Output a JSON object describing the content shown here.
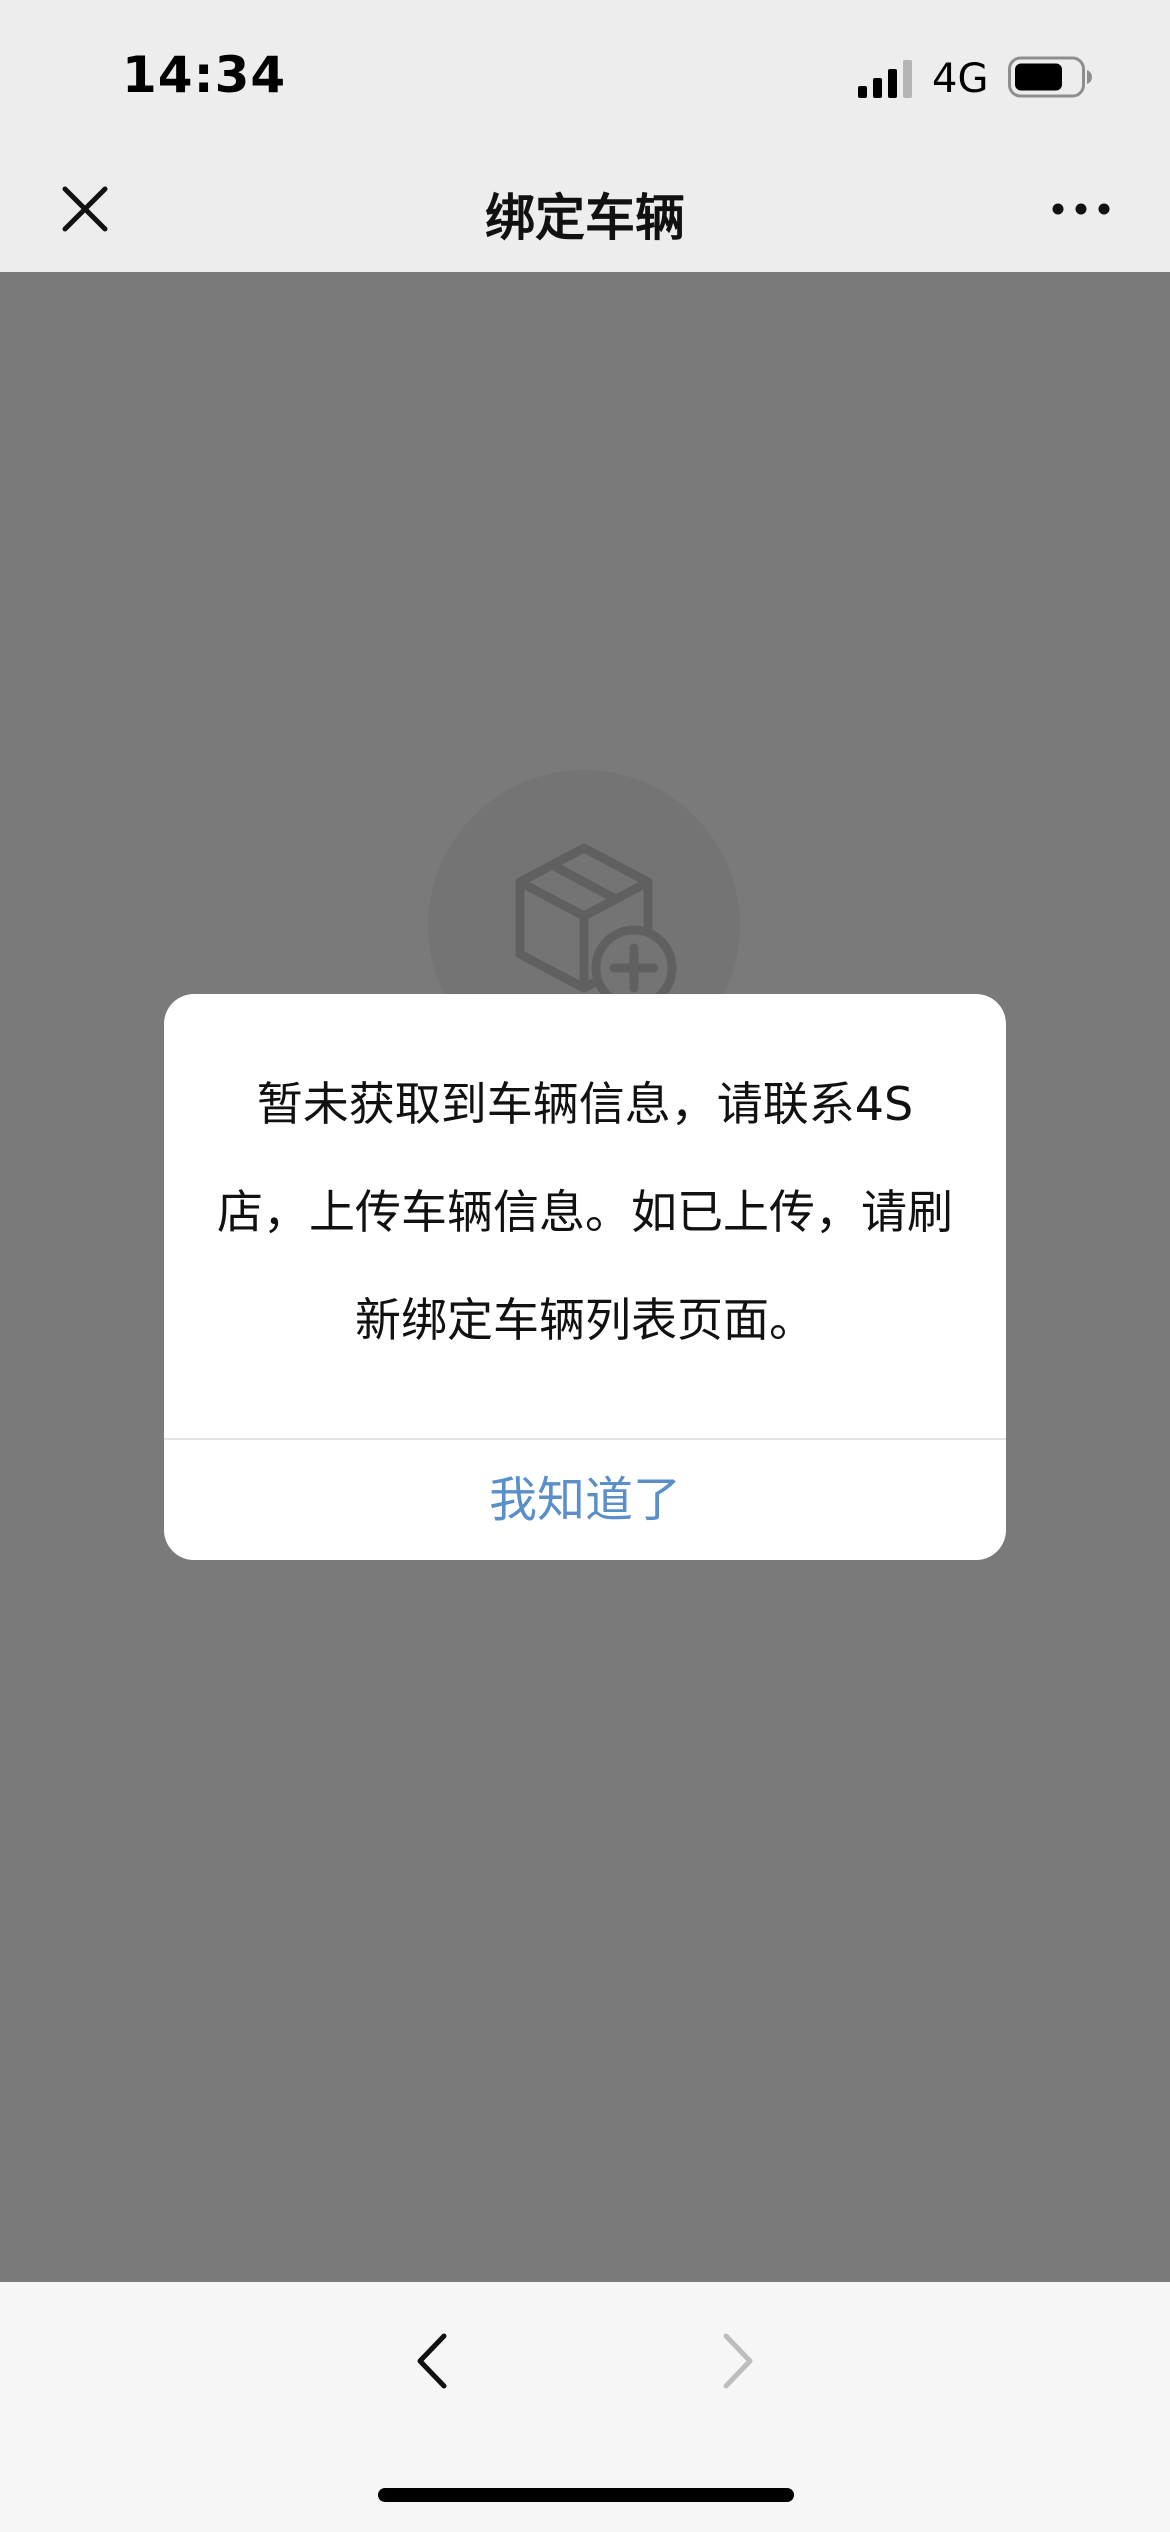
{
  "status_bar": {
    "time": "14:34",
    "network": "4G",
    "signal_bars": 3,
    "signal_bars_total": 4,
    "battery_level": 0.75
  },
  "nav": {
    "title": "绑定车辆",
    "close_icon": "close-icon",
    "more_icon": "more-icon"
  },
  "content": {
    "empty_icon": "box-add-icon"
  },
  "dialog": {
    "message": "暂未获取到车辆信息，请联系4S店，上传车辆信息。如已上传，请刷新绑定车辆列表页面。",
    "button_label": "我知道了"
  },
  "toolbar": {
    "back_icon": "chevron-left-icon",
    "forward_icon": "chevron-right-icon"
  },
  "colors": {
    "accent": "#5b8fc9",
    "bar_background": "#ededed",
    "overlay": "rgba(0,0,0,0.52)"
  }
}
